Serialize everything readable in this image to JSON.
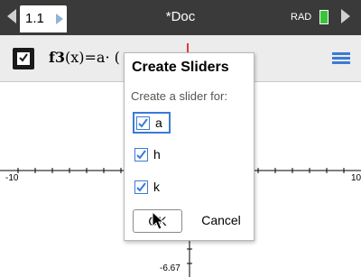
{
  "topbar": {
    "tab_label": "1.1",
    "doc_title": "*Doc",
    "mode": "RAD",
    "battery_color": "#39c43b"
  },
  "entry_line": {
    "formula_name": "f3",
    "formula_body": "(x)=a· (",
    "checked": true,
    "menu_icon": "menu-icon"
  },
  "graph": {
    "x_min_label": "-10",
    "x_max_label": "10",
    "y_min_label": "-6.67"
  },
  "dialog": {
    "title": "Create Sliders",
    "prompt": "Create a slider for:",
    "options": [
      {
        "label": "a",
        "checked": true
      },
      {
        "label": "h",
        "checked": true
      },
      {
        "label": "k",
        "checked": true
      }
    ],
    "ok_label": "OK",
    "cancel_label": "Cancel"
  },
  "colors": {
    "accent": "#3a7bd5",
    "topbar": "#3a3a3a",
    "cursor": "#e53935"
  }
}
